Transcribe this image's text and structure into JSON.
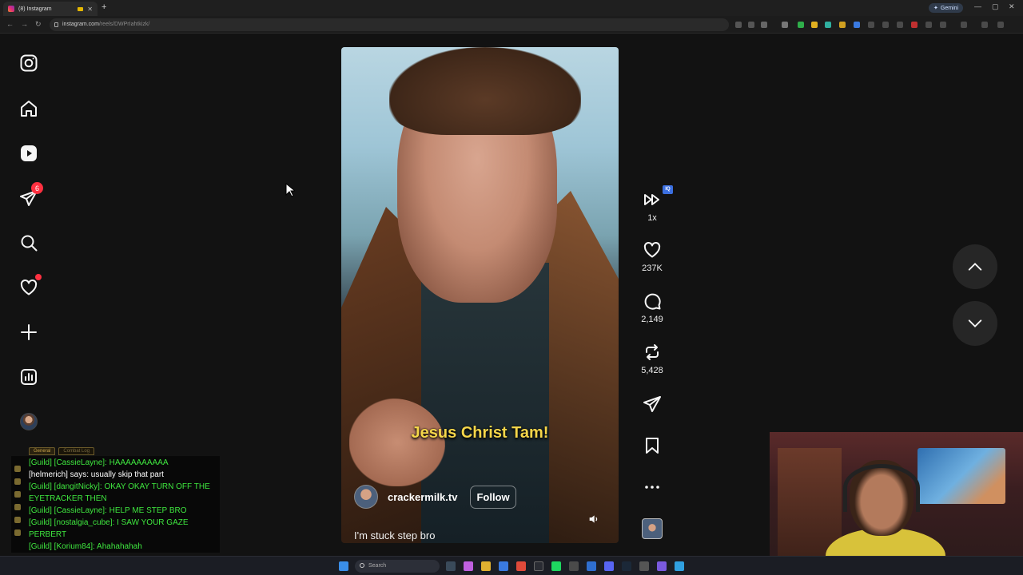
{
  "browser": {
    "tab_title": "(8) Instagram",
    "new_tab": "+",
    "url_host": "instagram.com",
    "url_path": "/reels/DWPrIahtkizk/",
    "gemini_label": "Gemini",
    "min": "—",
    "max": "▢",
    "close": "✕"
  },
  "sidebar": {
    "messages_badge": "6"
  },
  "reel": {
    "subtitle": "Jesus Christ Tam!",
    "author": "crackermilk.tv",
    "follow_label": "Follow",
    "caption": "I'm stuck step bro"
  },
  "actions": {
    "speed": "1x",
    "iq_badge": "IQ",
    "likes": "237K",
    "comments": "2,149",
    "reposts": "5,428"
  },
  "chat": {
    "tabs": [
      "General",
      "Combat Log"
    ],
    "lines": [
      {
        "text": "[Guild] [CassieLayne]: HAAAAAAAAAA",
        "type": "guild"
      },
      {
        "text": "[helmerich] says: usually skip that part",
        "type": "say"
      },
      {
        "text": "[Guild] [dangitNicky]: OKAY OKAY TURN OFF THE EYETRACKER THEN",
        "type": "guild"
      },
      {
        "text": "[Guild] [CassieLayne]: HELP ME STEP BRO",
        "type": "guild"
      },
      {
        "text": "[Guild] [nostalgia_cube]: I SAW YOUR GAZE PERBERT",
        "type": "guild"
      },
      {
        "text": "[Guild] [Korium84]: Ahahahahah",
        "type": "guild"
      }
    ]
  },
  "taskbar": {
    "search_placeholder": "Search"
  },
  "colors": {
    "background": "#121212",
    "subtitle_yellow": "#f5d64a",
    "badge_red": "#ff3040",
    "chat_guild_green": "#3fe83f"
  }
}
